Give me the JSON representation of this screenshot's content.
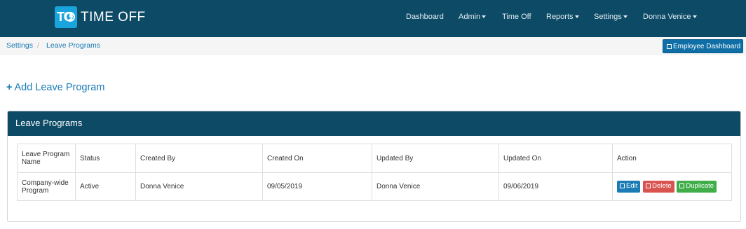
{
  "app": {
    "logo_mark": "TO",
    "logo_text": "TIME OFF"
  },
  "nav": {
    "dashboard": "Dashboard",
    "admin": "Admin",
    "time_off": "Time Off",
    "reports": "Reports",
    "settings": "Settings",
    "user": "Donna Venice"
  },
  "breadcrumb": {
    "settings": "Settings",
    "separator": "/",
    "current": "Leave Programs"
  },
  "employee_dashboard_label": "Employee Dashboard",
  "add_program_label": "Add Leave Program",
  "panel": {
    "title": "Leave Programs"
  },
  "table": {
    "headers": [
      "Leave Program Name",
      "Status",
      "Created By",
      "Created On",
      "Updated By",
      "Updated On",
      "Action"
    ],
    "rows": [
      {
        "name": "Company-wide Program",
        "status": "Active",
        "created_by": "Donna Venice",
        "created_on": "09/05/2019",
        "updated_by": "Donna Venice",
        "updated_on": "09/06/2019",
        "actions": {
          "edit": "Edit",
          "delete": "Delete",
          "duplicate": "Duplicate"
        }
      }
    ]
  },
  "colors": {
    "navbar": "#0c4a66",
    "link": "#1a7bb5",
    "edit": "#1a7bb5",
    "delete": "#d9534f",
    "duplicate": "#3fae49"
  }
}
